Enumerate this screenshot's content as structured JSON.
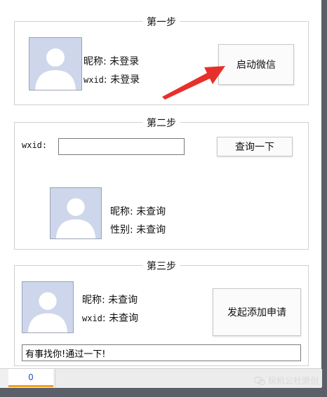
{
  "step1": {
    "title": "第一步",
    "nickname": "昵称: 未登录",
    "wxid_label": "wxid",
    "wxid_value": ": 未登录",
    "launch_button": "启动微信"
  },
  "step2": {
    "title": "第二步",
    "wxid_label": "wxid:",
    "wxid_input_value": "",
    "query_button": "查询一下",
    "nickname": "昵称: 未查询",
    "gender": "性别: 未查询"
  },
  "step3": {
    "title": "第三步",
    "nickname": "昵称: 未查询",
    "wxid_label": "wxid",
    "wxid_value": ": 未查询",
    "send_button": "发起添加申请",
    "message_value": "有事找你!通过一下!"
  },
  "tabs": [
    {
      "label": "0"
    }
  ],
  "watermark": {
    "text": "玩机公社原创"
  },
  "colors": {
    "arrow": "#e8302a",
    "tab_accent": "#f0a020",
    "avatar_bg": "#cdd6ea"
  }
}
